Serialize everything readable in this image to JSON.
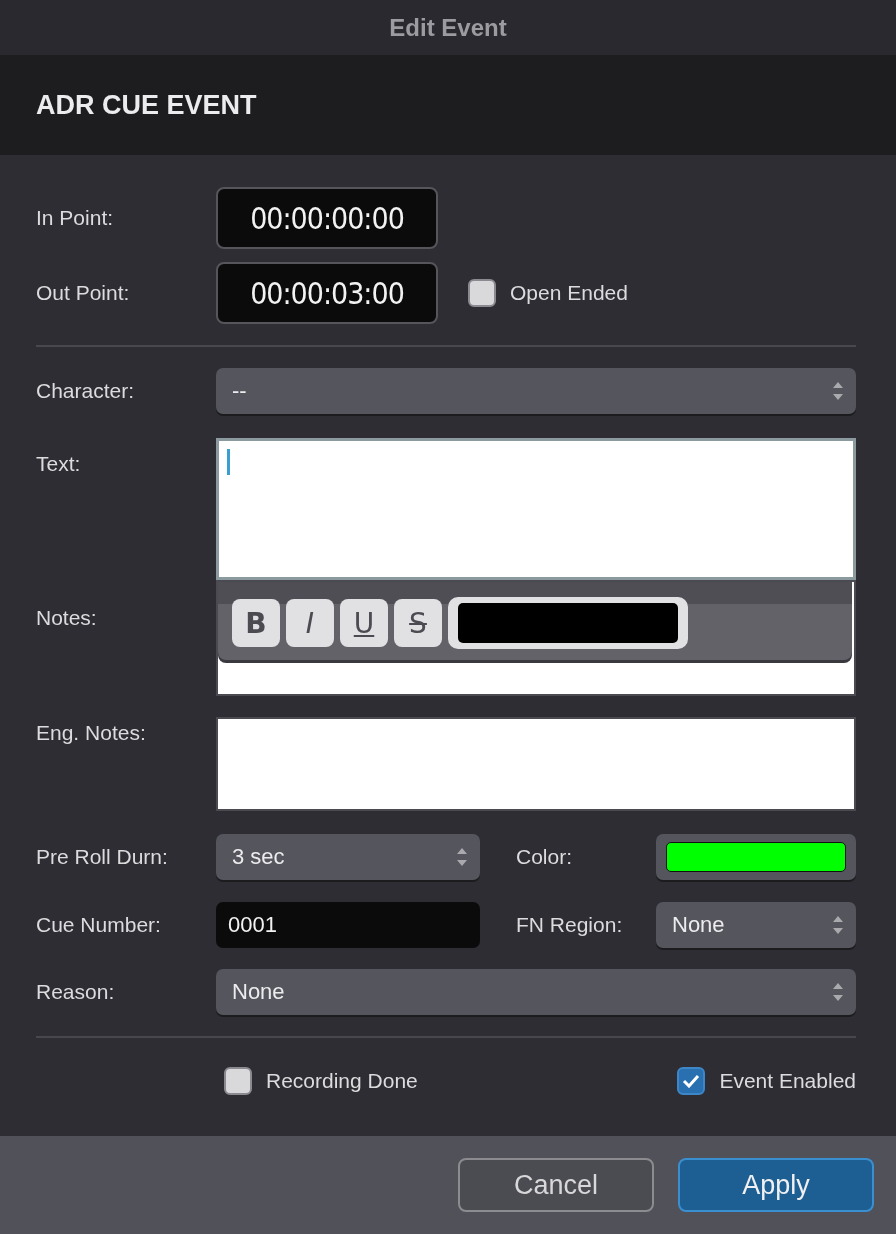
{
  "window": {
    "title": "Edit Event"
  },
  "header": {
    "title": "ADR CUE EVENT"
  },
  "in_point": {
    "label": "In Point:",
    "value": "00:00:00:00"
  },
  "out_point": {
    "label": "Out Point:",
    "value": "00:00:03:00"
  },
  "open_ended": {
    "label": "Open Ended",
    "checked": false
  },
  "character": {
    "label": "Character:",
    "value": "--"
  },
  "text": {
    "label": "Text:",
    "focused": true
  },
  "format_toolbar": {
    "buttons": [
      {
        "label": "B",
        "kind": "bold"
      },
      {
        "label": "I",
        "kind": "italic"
      },
      {
        "label": "U",
        "kind": "underline"
      },
      {
        "label": "S",
        "kind": "strike"
      }
    ],
    "color": "#000000"
  },
  "notes": {
    "label": "Notes:"
  },
  "eng_notes": {
    "label": "Eng. Notes:"
  },
  "pre_roll": {
    "label": "Pre Roll Durn:",
    "value": "3 sec"
  },
  "color": {
    "label": "Color:",
    "color": "#00ff00"
  },
  "cue_number": {
    "label": "Cue Number:",
    "value": "0001"
  },
  "fn_region": {
    "label": "FN Region:",
    "value": "None"
  },
  "reason": {
    "label": "Reason:",
    "value": "None"
  },
  "recording_done": {
    "label": "Recording Done",
    "checked": false
  },
  "event_enabled": {
    "label": "Event Enabled",
    "checked": true
  },
  "buttons": [
    {
      "label": "Cancel",
      "kind": "secondary"
    },
    {
      "label": "Apply",
      "kind": "primary"
    }
  ]
}
